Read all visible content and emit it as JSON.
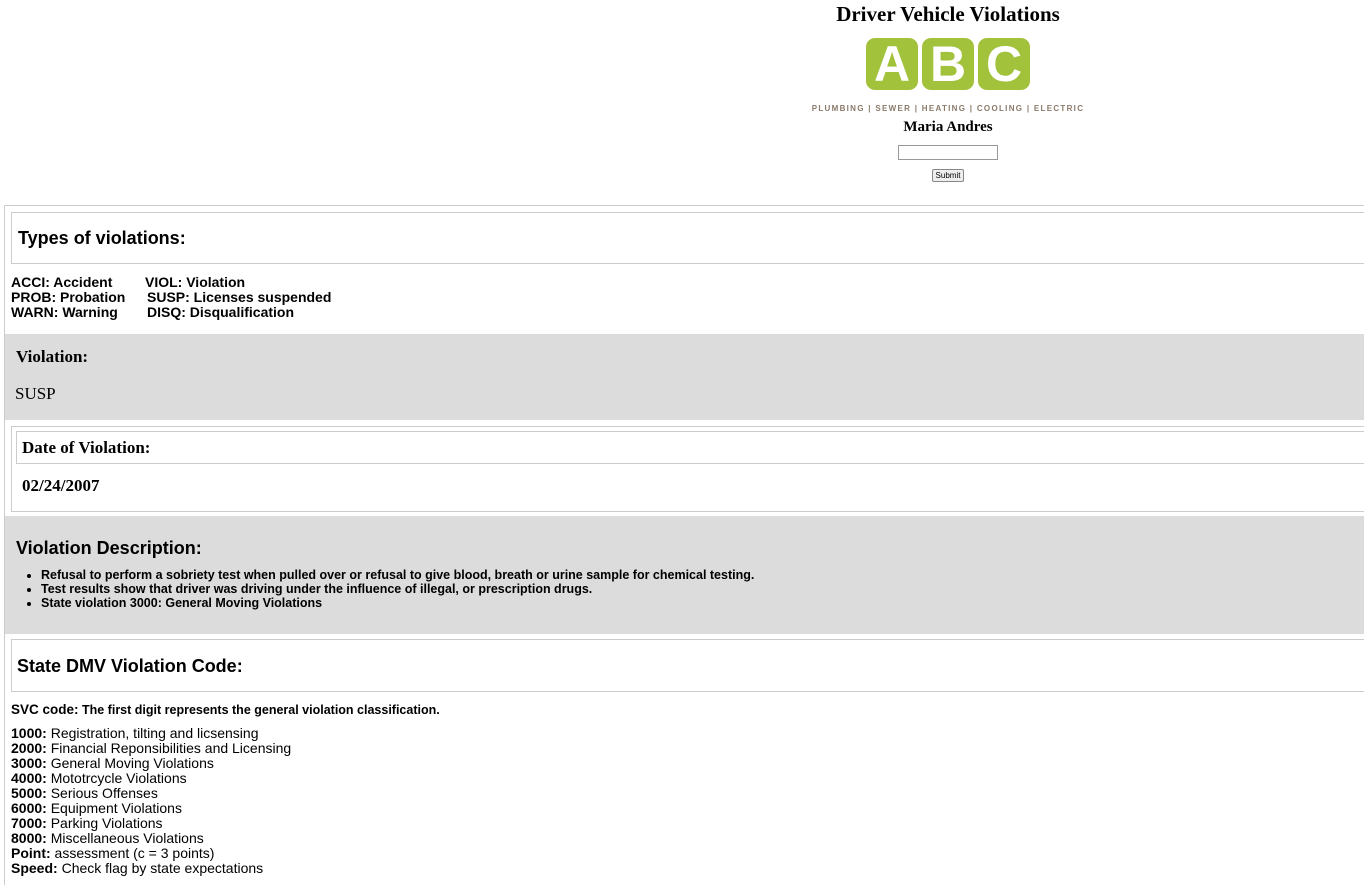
{
  "header": {
    "title": "Driver Vehicle Violations",
    "logo_letters": [
      "A",
      "B",
      "C"
    ],
    "logo_tagline": "PLUMBING | SEWER | HEATING | COOLING | ELECTRIC",
    "name": "Maria Andres",
    "input_value": "",
    "submit_label": "Submit"
  },
  "types": {
    "heading": "Types of violations:",
    "rows": [
      [
        "ACCI: Accident",
        "VIOL: Violation"
      ],
      [
        "PROB: Probation",
        "SUSP: Licenses suspended"
      ],
      [
        "WARN: Warning",
        "DISQ: Disqualification"
      ]
    ]
  },
  "violation": {
    "label": "Violation:",
    "value": "SUSP"
  },
  "date": {
    "label": "Date of Violation:",
    "value": "02/24/2007"
  },
  "description": {
    "heading": "Violation Description:",
    "items": [
      "Refusal to perform a sobriety test when pulled over or refusal to give blood, breath or urine sample for chemical testing.",
      "Test results show that driver was driving under the influence of illegal, or prescription drugs.",
      "State violation 3000: General Moving Violations"
    ]
  },
  "dmv": {
    "heading": "State DMV Violation Code:",
    "svc_key": "SVC code:",
    "svc_text": " The first digit represents the general violation classification.",
    "codes": [
      {
        "k": "1000:",
        "v": " Registration, tilting and licsensing"
      },
      {
        "k": "2000:",
        "v": " Financial Reponsibilities and Licensing"
      },
      {
        "k": "3000:",
        "v": " General Moving Violations"
      },
      {
        "k": "4000:",
        "v": " Mototrcycle Violations"
      },
      {
        "k": "5000:",
        "v": " Serious Offenses"
      },
      {
        "k": "6000:",
        "v": " Equipment Violations"
      },
      {
        "k": "7000:",
        "v": " Parking Violations"
      },
      {
        "k": "8000:",
        "v": " Miscellaneous Violations"
      },
      {
        "k": "Point:",
        "v": " assessment (c = 3 points)"
      },
      {
        "k": "Speed:",
        "v": " Check flag by state expectations"
      }
    ]
  }
}
